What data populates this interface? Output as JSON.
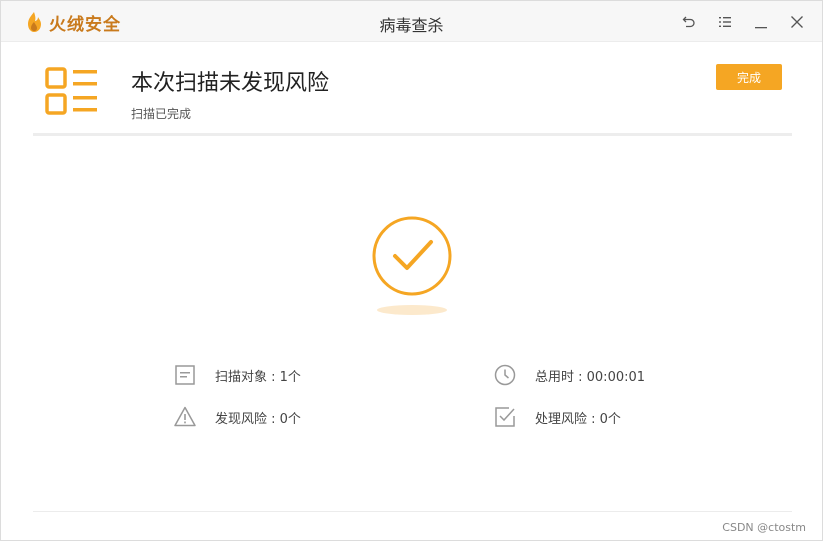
{
  "app": {
    "brand": "火绒安全",
    "window_title": "病毒查杀"
  },
  "colors": {
    "accent": "#f5a623",
    "brand": "#c97a1c"
  },
  "icons": {
    "window": [
      "back-icon",
      "menu-icon",
      "minimize-icon",
      "close-icon"
    ],
    "header": "report-list-icon",
    "result": "check-circle-icon",
    "stats": [
      "document-icon",
      "clock-icon",
      "warning-icon",
      "check-square-icon"
    ]
  },
  "header": {
    "title": "本次扫描未发现风险",
    "subtitle": "扫描已完成",
    "done_label": "完成"
  },
  "stats": {
    "scan_objects": "扫描对象 : 1个",
    "total_time": "总用时 : 00:00:01",
    "found_risks": "发现风险 : 0个",
    "handled_risks": "处理风险 : 0个"
  },
  "watermark": "CSDN @ctostm"
}
